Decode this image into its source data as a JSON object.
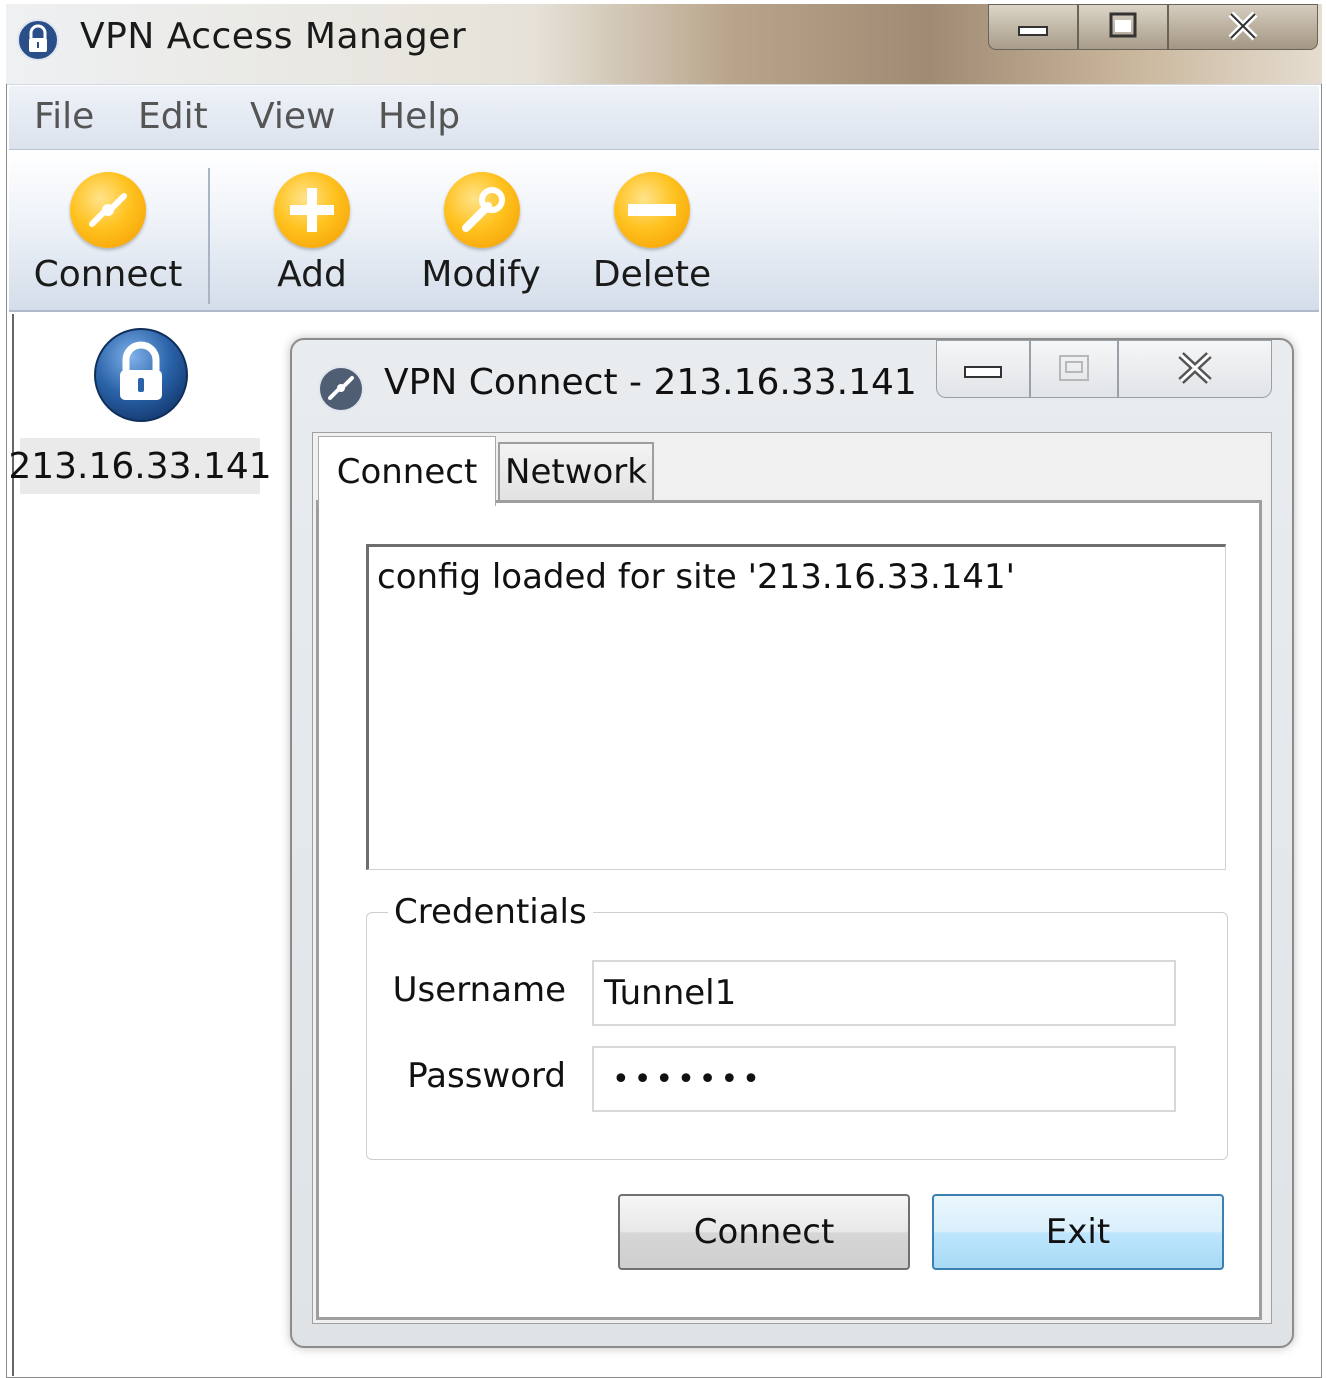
{
  "main_window": {
    "title": "VPN Access Manager",
    "menu": [
      "File",
      "Edit",
      "View",
      "Help"
    ],
    "toolbar": {
      "connect": "Connect",
      "add": "Add",
      "modify": "Modify",
      "delete": "Delete"
    },
    "connections": [
      {
        "label": "213.16.33.141",
        "icon": "padlock-icon"
      }
    ]
  },
  "dialog": {
    "title": "VPN Connect - 213.16.33.141",
    "tabs": [
      "Connect",
      "Network"
    ],
    "active_tab": "Connect",
    "log_text": "config loaded for site '213.16.33.141'",
    "credentials": {
      "group_label": "Credentials",
      "username_label": "Username",
      "username_value": "Tunnel1",
      "password_label": "Password",
      "password_value": "•••••••"
    },
    "buttons": {
      "connect": "Connect",
      "exit": "Exit"
    }
  },
  "colors": {
    "toolbar_icon": "#ffc21f",
    "selection_blue": "#3c7fb1",
    "padlock_blue": "#2a63a8"
  }
}
